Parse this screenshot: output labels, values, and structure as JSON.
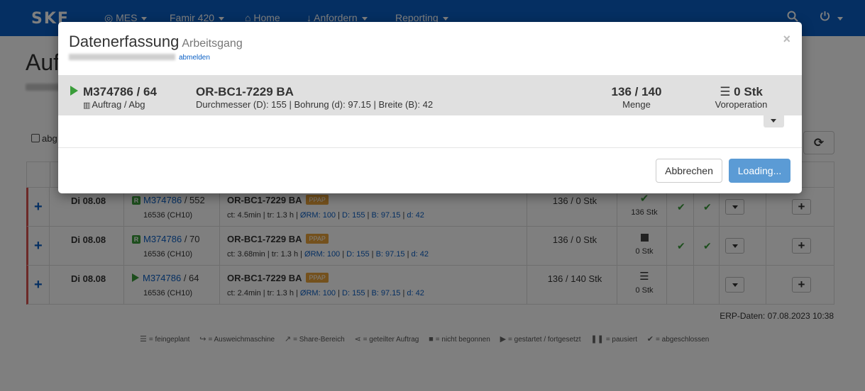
{
  "navbar": {
    "brand": "SKF",
    "items": [
      {
        "icon": "target-icon",
        "label": "MES"
      },
      {
        "label": "Famir 420"
      },
      {
        "icon": "home-icon",
        "label": "Home"
      },
      {
        "icon": "arrow-down-icon",
        "label": "Anfordern"
      },
      {
        "label": "Reporting"
      }
    ]
  },
  "page": {
    "title": "Aufträge",
    "checkbox_label": "abg"
  },
  "rows": [
    {
      "date": "Di 08.08",
      "badge": "R",
      "order_link": "M374786",
      "order_suffix": " / 552",
      "machine": "16536 (CH10)",
      "article": "OR-BC1-7229 BA",
      "tag": "PPAP",
      "ct": "ct: 4.5min | tr: 1.3 h | ",
      "orm": "ØRM: 100",
      "d1": "D: 155",
      "b": "B: 97.15",
      "d2": "d: 42",
      "qty": "136 / 0 Stk",
      "status_label": "136 Stk"
    },
    {
      "date": "Di 08.08",
      "badge": "R",
      "order_link": "M374786",
      "order_suffix": " / 70",
      "machine": "16536 (CH10)",
      "article": "OR-BC1-7229 BA",
      "tag": "PPAP",
      "ct": "ct: 3.68min | tr: 1.3 h | ",
      "orm": "ØRM: 100",
      "d1": "D: 155",
      "b": "B: 97.15",
      "d2": "d: 42",
      "qty": "136 / 0 Stk",
      "status_label": "0 Stk"
    },
    {
      "date": "Di 08.08",
      "badge": "",
      "order_link": "M374786",
      "order_suffix": " / 64",
      "machine": "16536 (CH10)",
      "article": "OR-BC1-7229 BA",
      "tag": "PPAP",
      "ct": "ct: 2.4min | tr: 1.3 h | ",
      "orm": "ØRM: 100",
      "d1": "D: 155",
      "b": "B: 97.15",
      "d2": "d: 42",
      "qty": "136 / 140 Stk",
      "status_label": "0 Stk"
    }
  ],
  "erp": "ERP-Daten: 07.08.2023 10:38",
  "legend": [
    {
      "icon": "list-icon",
      "text": "= feingeplant"
    },
    {
      "icon": "redirect-icon",
      "text": "= Ausweichmaschine"
    },
    {
      "icon": "share-icon",
      "text": "= Share-Bereich"
    },
    {
      "icon": "share-nodes-icon",
      "text": "= geteilter Auftrag"
    },
    {
      "icon": "stop-icon",
      "text": "= nicht begonnen"
    },
    {
      "icon": "play-icon",
      "text": "= gestartet / fortgesetzt"
    },
    {
      "icon": "pause-icon",
      "text": "= pausiert"
    },
    {
      "icon": "check-icon",
      "text": "= abgeschlossen"
    }
  ],
  "modal": {
    "title": "Datenerfassung",
    "subtitle": "Arbeitsgang",
    "logout": "abmelden",
    "order": "M374786 / 64",
    "order_sub": "Auftrag / Abg",
    "article": "OR-BC1-7229 BA",
    "article_sub": "Durchmesser (D): 155 | Bohrung (d): 97.15 | Breite (B): 42",
    "qty": "136 / 140",
    "qty_sub": "Menge",
    "vorop": "0 Stk",
    "vorop_sub": "Voroperation",
    "cancel": "Abbrechen",
    "loading": "Loading..."
  }
}
